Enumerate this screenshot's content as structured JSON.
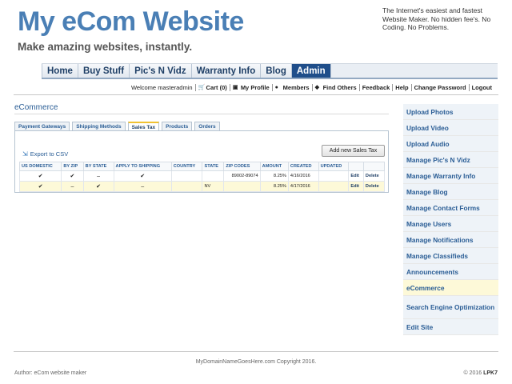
{
  "header": {
    "title": "My eCom Website",
    "subtitle": "Make amazing websites, instantly.",
    "tagline": "The Internet's easiest and fastest Website Maker. No hidden fee's. No Coding. No Problems."
  },
  "topnav": {
    "tabs": [
      {
        "label": "Home"
      },
      {
        "label": "Buy Stuff"
      },
      {
        "label": "Pic's N Vidz"
      },
      {
        "label": "Warranty Info"
      },
      {
        "label": "Blog"
      },
      {
        "label": "Admin"
      }
    ],
    "active": "Admin"
  },
  "userbar": {
    "welcome": "Welcome masteradmin",
    "cart": "Cart (0)",
    "profile": "My Profile",
    "members": "Members",
    "find_others": "Find Others",
    "feedback": "Feedback",
    "help": "Help",
    "change_password": "Change Password",
    "logout": "Logout"
  },
  "main": {
    "section_title": "eCommerce",
    "subtabs": [
      "Payment Gateways",
      "Shipping Methods",
      "Sales Tax",
      "Products",
      "Orders"
    ],
    "active_subtab": "Sales Tax",
    "export_label": "Export to CSV",
    "add_button": "Add new Sales Tax",
    "table": {
      "headers": [
        "US DOMESTIC",
        "BY ZIP",
        "BY STATE",
        "APPLY TO SHIPPING",
        "COUNTRY",
        "STATE",
        "ZIP CODES",
        "AMOUNT",
        "CREATED",
        "UPDATED",
        "",
        ""
      ],
      "rows": [
        {
          "us_domestic": "✔",
          "by_zip": "✔",
          "by_state": "–",
          "apply_shipping": "✔",
          "country": "",
          "state": "",
          "zip_codes": "89002-89074",
          "amount": "8.25%",
          "created": "4/16/2016",
          "updated": "",
          "edit": "Edit",
          "delete": "Delete"
        },
        {
          "us_domestic": "✔",
          "by_zip": "–",
          "by_state": "✔",
          "apply_shipping": "–",
          "country": "",
          "state": "NV",
          "zip_codes": "",
          "amount": "8.25%",
          "created": "4/17/2016",
          "updated": "",
          "edit": "Edit",
          "delete": "Delete"
        }
      ]
    }
  },
  "sidebar": {
    "items": [
      "Upload Photos",
      "Upload Video",
      "Upload Audio",
      "Manage Pic's N Vidz",
      "Manage Warranty Info",
      "Manage Blog",
      "Manage Contact Forms",
      "Manage Users",
      "Manage Notifications",
      "Manage Classifieds",
      "Announcements",
      "eCommerce",
      "Search Engine Optimization",
      "Edit Site"
    ],
    "active": "eCommerce"
  },
  "footer": {
    "copyright": "MyDomainNameGoesHere.com Copyright 2016.",
    "author": "Author: eCom website maker",
    "brand_prefix": "© 2016",
    "brand_name": "LPK7"
  },
  "colors": {
    "accent": "#4a7fb5",
    "nav_active": "#1f4e8a",
    "highlight_row": "#fdf9d8"
  }
}
